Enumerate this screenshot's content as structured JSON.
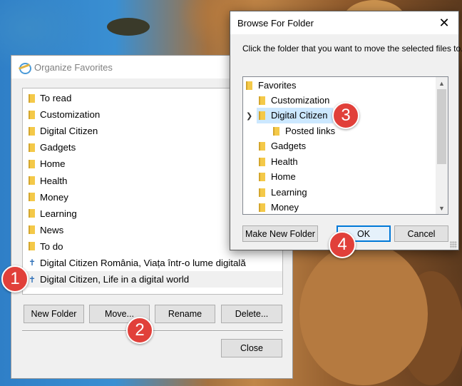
{
  "organize": {
    "title": "Organize Favorites",
    "items": [
      {
        "label": "To read",
        "type": "folder"
      },
      {
        "label": "Customization",
        "type": "folder"
      },
      {
        "label": "Digital Citizen",
        "type": "folder"
      },
      {
        "label": "Gadgets",
        "type": "folder"
      },
      {
        "label": "Home",
        "type": "folder"
      },
      {
        "label": "Health",
        "type": "folder"
      },
      {
        "label": "Money",
        "type": "folder"
      },
      {
        "label": "Learning",
        "type": "folder"
      },
      {
        "label": "News",
        "type": "folder"
      },
      {
        "label": "To do",
        "type": "folder"
      },
      {
        "label": "Digital Citizen România, Viața într-o lume digitală",
        "type": "link"
      },
      {
        "label": "Digital Citizen, Life in a digital world",
        "type": "link",
        "selected": true
      }
    ],
    "buttons": {
      "new_folder": "New Folder",
      "move": "Move...",
      "rename": "Rename",
      "delete": "Delete...",
      "close": "Close"
    }
  },
  "browse": {
    "title": "Browse For Folder",
    "close_glyph": "✕",
    "instruction": "Click the folder that you want to move the selected files to.",
    "tree": [
      {
        "label": "Favorites",
        "level": 0
      },
      {
        "label": "Customization",
        "level": 1
      },
      {
        "label": "Digital Citizen",
        "level": 1,
        "expanded": true,
        "selected": true
      },
      {
        "label": "Posted links",
        "level": 2
      },
      {
        "label": "Gadgets",
        "level": 1
      },
      {
        "label": "Health",
        "level": 1
      },
      {
        "label": "Home",
        "level": 1
      },
      {
        "label": "Learning",
        "level": 1
      },
      {
        "label": "Money",
        "level": 1
      }
    ],
    "buttons": {
      "make_new_folder": "Make New Folder",
      "ok": "OK",
      "cancel": "Cancel"
    }
  },
  "markers": [
    "1",
    "2",
    "3",
    "4"
  ],
  "colors": {
    "marker": "#e1403a",
    "selection": "#cce8ff",
    "folder": "#f4c949",
    "default_button_border": "#0078d7"
  },
  "icons": {
    "folder": "folder-icon",
    "link": "favorite-link-icon",
    "app": "internet-explorer-icon",
    "close": "close-icon"
  }
}
